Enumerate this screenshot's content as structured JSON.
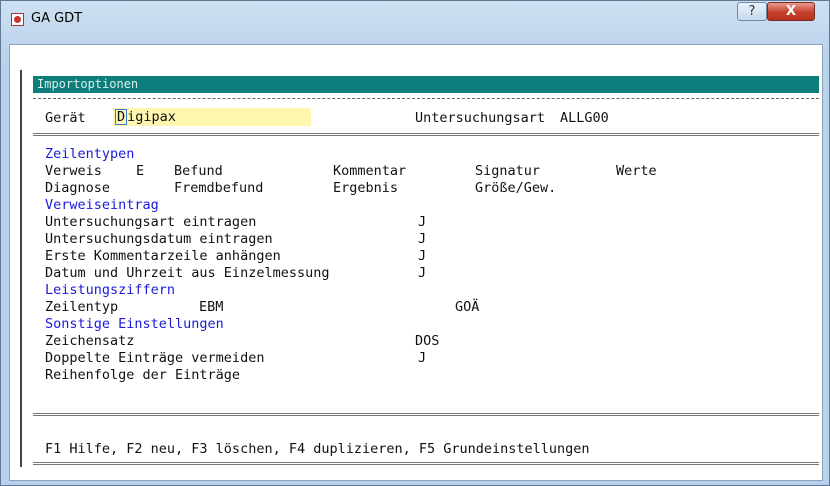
{
  "window": {
    "title": "GA GDT",
    "help": "?",
    "close": "X"
  },
  "header": {
    "bar_title": "Importoptionen"
  },
  "device": {
    "label": "Gerät",
    "value_first": "D",
    "value_rest": "igipax",
    "exam_type_label": "Untersuchungsart",
    "exam_type_value": "ALLG00"
  },
  "zeilentypen": {
    "heading": "Zeilentypen",
    "row1": [
      "Verweis",
      "E",
      "Befund",
      "Kommentar",
      "Signatur",
      "Werte"
    ],
    "row2": [
      "Diagnose",
      "Fremdbefund",
      "Ergebnis",
      "Größe/Gew."
    ]
  },
  "verweiseintrag": {
    "heading": "Verweiseintrag",
    "items": [
      {
        "label": "Untersuchungsart eintragen",
        "value": "J"
      },
      {
        "label": "Untersuchungsdatum eintragen",
        "value": "J"
      },
      {
        "label": "Erste Kommentarzeile anhängen",
        "value": "J"
      },
      {
        "label": "Datum und Uhrzeit aus Einzelmessung",
        "value": "J"
      }
    ]
  },
  "leistungsziffern": {
    "heading": "Leistungsziffern",
    "label": "Zeilentyp",
    "ebm": "EBM",
    "goa": "GOÄ"
  },
  "sonstige": {
    "heading": "Sonstige Einstellungen",
    "charset_label": "Zeichensatz",
    "charset_value": "DOS",
    "dup_label": "Doppelte Einträge vermeiden",
    "dup_value": "J",
    "order_label": "Reihenfolge der Einträge"
  },
  "footer": {
    "help": "F1 Hilfe, F2 neu, F3 löschen, F4 duplizieren, F5 Grundeinstellungen"
  }
}
